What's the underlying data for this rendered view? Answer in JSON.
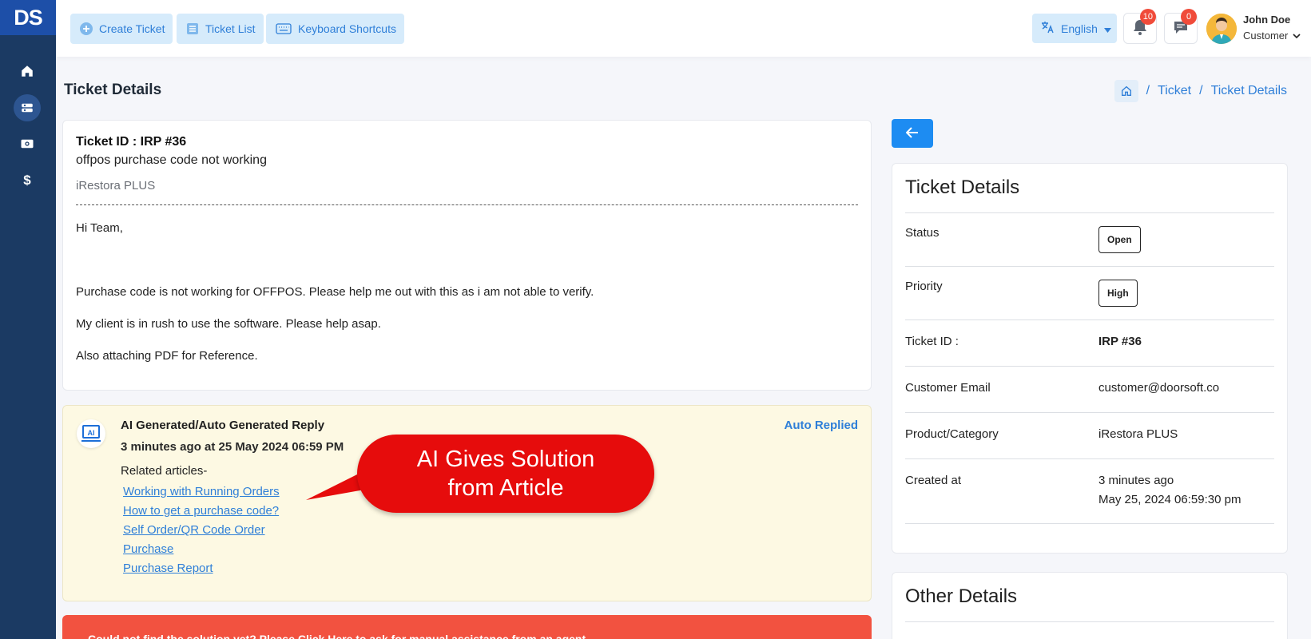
{
  "sidebar": {
    "logo": "DS",
    "dollar_label": "$"
  },
  "topbar": {
    "create_ticket": "Create Ticket",
    "ticket_list": "Ticket List",
    "keyboard_shortcuts": "Keyboard Shortcuts",
    "language": "English",
    "notifications_count": "10",
    "messages_count": "0",
    "user_name": "John Doe",
    "user_role": "Customer"
  },
  "page": {
    "title": "Ticket Details",
    "breadcrumb": [
      "Ticket",
      "Ticket Details"
    ]
  },
  "ticket": {
    "id_line": "Ticket ID : IRP #36",
    "subject": "offpos purchase code not working",
    "product": "iRestora PLUS",
    "body": [
      "Hi Team,",
      "Purchase code is not working for OFFPOS. Please help me out with this as i am not able to verify.",
      "My client is in rush to use the software. Please help asap.",
      "Also attaching PDF for Reference."
    ]
  },
  "ai_reply": {
    "icon_text": "AI",
    "title": "AI Generated/Auto Generated Reply",
    "time": "3 minutes ago at 25 May 2024 06:59 PM",
    "status": "Auto Replied",
    "related_label": "Related articles-",
    "links": [
      "Working with Running Orders",
      "How to get a purchase code?",
      "Self Order/QR Code Order",
      "Purchase",
      "Purchase Report"
    ]
  },
  "callout": {
    "line1": "AI Gives Solution",
    "line2": "from Article"
  },
  "alert": {
    "text": "Could not find the solution yet? Please Click Here to ask for manual assistance from an agent"
  },
  "details": {
    "title": "Ticket Details",
    "status_label": "Status",
    "status_value": "Open",
    "priority_label": "Priority",
    "priority_value": "High",
    "id_label": "Ticket ID :",
    "id_value": "IRP #36",
    "email_label": "Customer Email",
    "email_value": "customer@doorsoft.co",
    "product_label": "Product/Category",
    "product_value": "iRestora PLUS",
    "created_label": "Created at",
    "created_relative": "3 minutes ago",
    "created_value": "May 25, 2024 06:59:30 pm"
  },
  "other": {
    "title": "Other Details"
  },
  "colors": {
    "sidebar": "#1b3a63",
    "accent": "#2f7fd8",
    "callout": "#e60c0c",
    "alert": "#f25240",
    "ai_card": "#fdf9e3"
  }
}
